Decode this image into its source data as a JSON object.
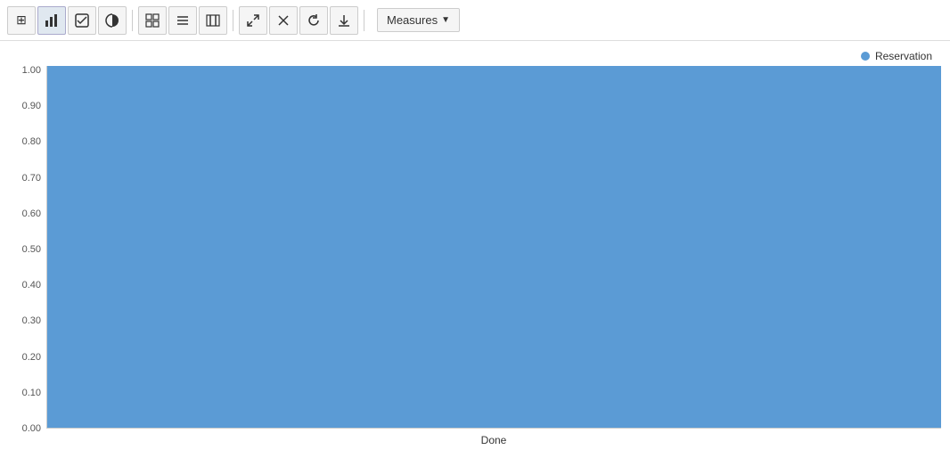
{
  "toolbar": {
    "measures_label": "Measures",
    "buttons": [
      {
        "id": "table-icon",
        "symbol": "⊞",
        "title": "Table"
      },
      {
        "id": "bar-chart-icon",
        "symbol": "📊",
        "title": "Bar Chart"
      },
      {
        "id": "checkbox-icon",
        "symbol": "✔",
        "title": "Checkbox"
      },
      {
        "id": "info-icon",
        "symbol": "ℹ",
        "title": "Info"
      },
      {
        "id": "grid-icon",
        "symbol": "▦",
        "title": "Grid"
      },
      {
        "id": "list-icon",
        "symbol": "≡",
        "title": "List"
      },
      {
        "id": "columns-icon",
        "symbol": "⫾",
        "title": "Columns"
      },
      {
        "id": "expand-icon",
        "symbol": "↗",
        "title": "Expand"
      },
      {
        "id": "close-icon",
        "symbol": "✕",
        "title": "Close"
      },
      {
        "id": "refresh-icon",
        "symbol": "↻",
        "title": "Refresh"
      },
      {
        "id": "download-icon",
        "symbol": "⬇",
        "title": "Download"
      }
    ]
  },
  "chart": {
    "legend": {
      "label": "Reservation",
      "color": "#5b9bd5"
    },
    "y_axis": {
      "labels": [
        "1.00",
        "0.90",
        "0.80",
        "0.70",
        "0.60",
        "0.50",
        "0.40",
        "0.30",
        "0.20",
        "0.10",
        "0.00"
      ]
    },
    "x_axis": {
      "label": "Done"
    },
    "bar_height_percent": 100
  }
}
